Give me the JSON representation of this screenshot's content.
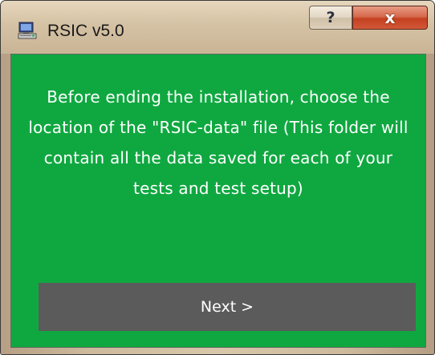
{
  "window": {
    "title": "RSIC v5.0",
    "app_icon": "computer-installer-icon",
    "help_glyph": "?",
    "close_glyph": "x"
  },
  "content": {
    "message": "Before ending the installation, choose the location of the \"RSIC-data\" file (This folder will contain all the data saved for each of your tests and test setup)",
    "next_label": "Next >"
  },
  "colors": {
    "background": "#0fa840",
    "button": "#5b5b5b",
    "text": "#ffffff"
  }
}
